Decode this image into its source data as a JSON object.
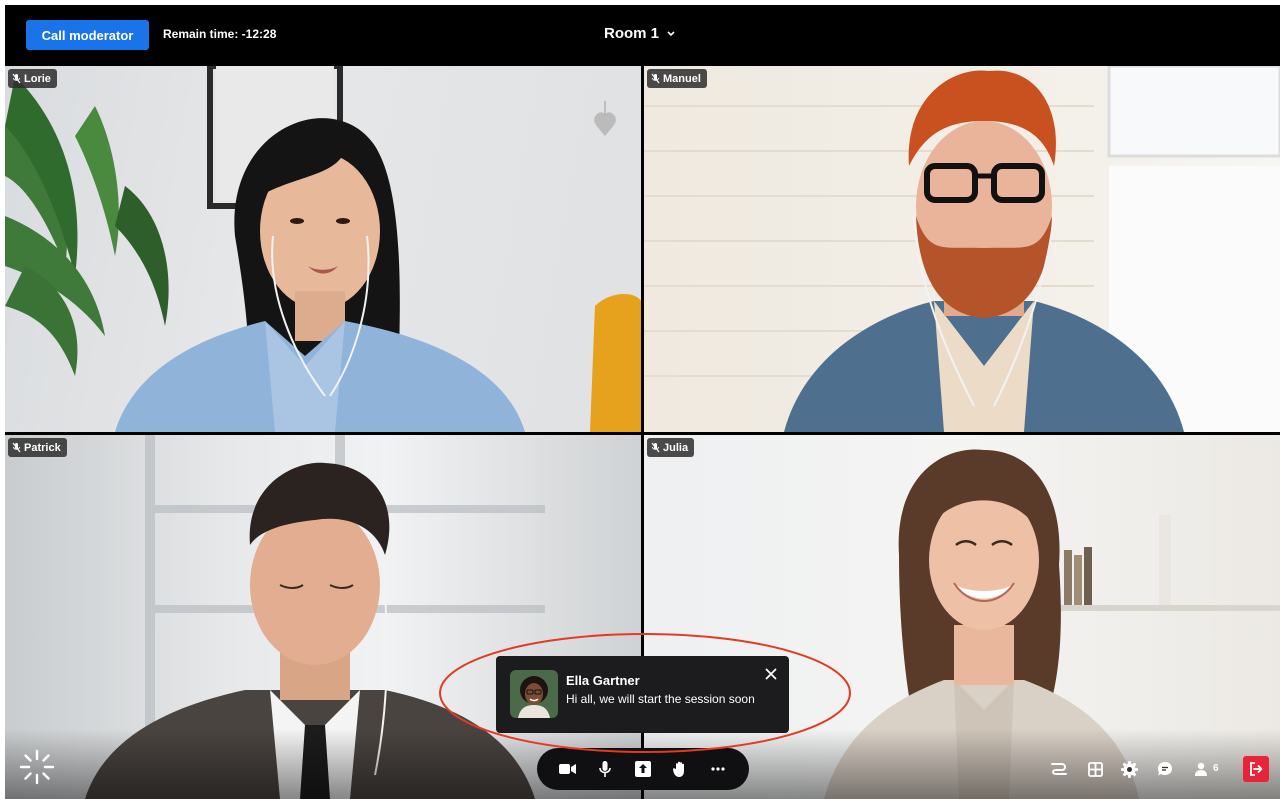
{
  "topbar": {
    "call_moderator": "Call moderator",
    "remain_time": "Remain time: -12:28",
    "room_title": "Room 1"
  },
  "participants": [
    {
      "name": "Lorie",
      "muted": true
    },
    {
      "name": "Manuel",
      "muted": true
    },
    {
      "name": "Patrick",
      "muted": true
    },
    {
      "name": "Julia",
      "muted": true
    }
  ],
  "notification": {
    "sender": "Ella Gartner",
    "message": "Hi all, we will start the session soon"
  },
  "controls": {
    "icons": [
      "camera-icon",
      "microphone-icon",
      "share-screen-icon",
      "raise-hand-icon",
      "more-icon"
    ]
  },
  "right_tools": {
    "icons": [
      "breakout-icon",
      "grid-layout-icon",
      "settings-icon",
      "chat-icon",
      "participants-icon",
      "leave-icon"
    ],
    "participant_count": "6"
  },
  "colors": {
    "accent": "#1a73e8",
    "leave": "#e8243a",
    "highlight_ring": "#e33b22"
  }
}
